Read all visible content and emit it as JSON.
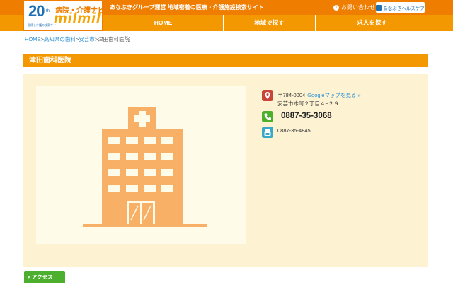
{
  "header": {
    "logo": {
      "years": "20",
      "years_suffix": "th",
      "brand_top": "病院・介護ナビ",
      "brand_main": "milmil",
      "brand_sub": "医療と介護の検索サイト"
    },
    "tagline": "あなぶきグループ運営 地域密着の医療・介護施設検索サイト",
    "contact_label": "お問い合わせ",
    "health_button_label": "あなぶきヘルスケア"
  },
  "nav": {
    "home": "HOME",
    "area": "地域で探す",
    "jobs": "求人を探す"
  },
  "breadcrumb": {
    "home": "HOME",
    "pref": "高知県の歯科",
    "city": "安芸市",
    "current": "津田歯科医院",
    "separator": ">"
  },
  "facility": {
    "name": "津田歯科医院",
    "postal": "〒784-0004",
    "map_link": "Googleマップを見る »",
    "address": "安芸市本町２丁目４−２９",
    "tel": "0887-35-3068",
    "fax": "0887-35-4845"
  },
  "sections": {
    "access": "▾ アクセス"
  },
  "colors": {
    "brand_orange": "#f39800",
    "topbar_orange": "#ef7d00",
    "panel_bg": "#fdf3d2",
    "building": "#f7b066",
    "link_blue": "#2a8fd6"
  },
  "icons": {
    "contact": "info-circle-icon",
    "address": "map-pin-icon",
    "tel": "phone-icon",
    "fax": "fax-icon"
  }
}
